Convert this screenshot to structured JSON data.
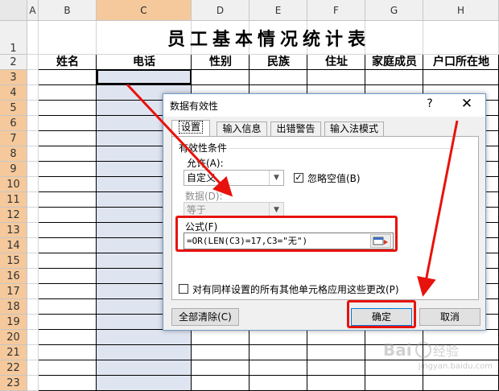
{
  "spreadsheet": {
    "columns": [
      "A",
      "B",
      "C",
      "D",
      "E",
      "F",
      "G",
      "H"
    ],
    "selected_column": "C",
    "rows": [
      "1",
      "2",
      "3",
      "4",
      "5",
      "6",
      "7",
      "8",
      "9",
      "10",
      "11",
      "12",
      "13",
      "14",
      "15",
      "16",
      "17",
      "18",
      "19",
      "20",
      "21",
      "22",
      "23"
    ],
    "title": "员工基本情况统计表",
    "headers": [
      "姓名",
      "电话",
      "性别",
      "民族",
      "住址",
      "家庭成员",
      "户口所在地"
    ]
  },
  "dialog": {
    "title": "数据有效性",
    "help_glyph": "?",
    "close_glyph": "✕",
    "tabs": [
      "设置",
      "输入信息",
      "出错警告",
      "输入法模式"
    ],
    "active_tab": "设置",
    "group_label": "有效性条件",
    "allow_label": "允许(A):",
    "allow_value": "自定义",
    "ignore_blank_label": "忽略空值(B)",
    "ignore_blank_checked": true,
    "data_label": "数据(D):",
    "data_value": "等于",
    "formula_label": "公式(F)",
    "formula_value": "=OR(LEN(C3)=17,C3=\"无\")",
    "apply_all_label": "对有同样设置的所有其他单元格应用这些更改(P)",
    "apply_all_checked": false,
    "clear_all_button": "全部清除(C)",
    "ok_button": "确定",
    "cancel_button": "取消"
  },
  "annotation_color": "#e8120c",
  "watermark": {
    "brand": "Baidu",
    "url": "jingyan.baidu.com"
  }
}
